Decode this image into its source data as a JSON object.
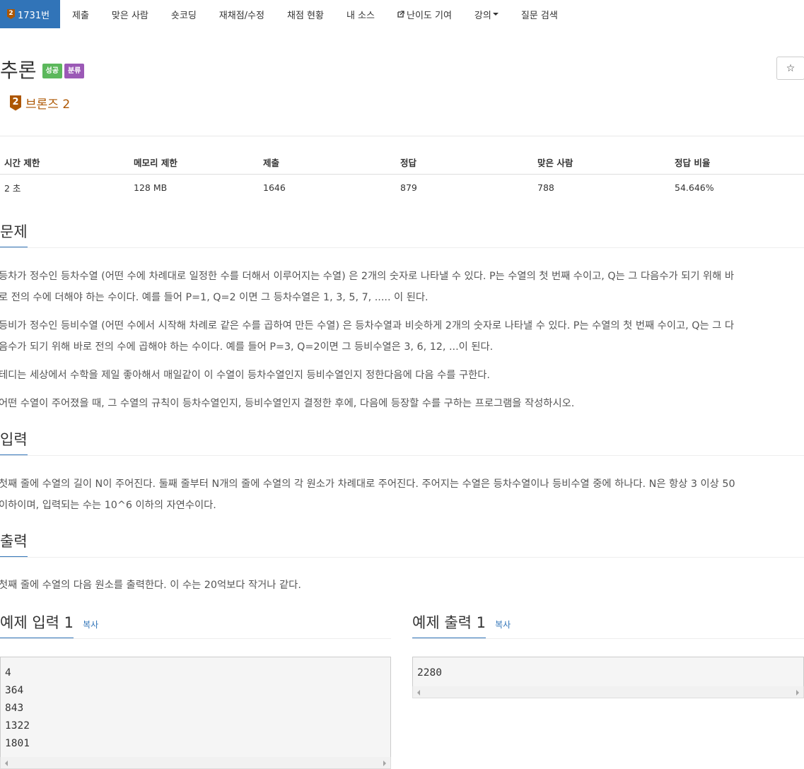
{
  "nav": {
    "problem_tab": {
      "tier_badge": "2",
      "label": "1731번"
    },
    "items": [
      "제출",
      "맞은 사람",
      "숏코딩",
      "재채점/수정",
      "채점 현황",
      "내 소스",
      "난이도 기여",
      "강의",
      "질문 검색"
    ]
  },
  "problem": {
    "title": "추론",
    "labels": [
      "성공",
      "분류"
    ],
    "star": "☆",
    "tier": {
      "number": "2",
      "name": "브론즈 2"
    }
  },
  "info": {
    "headers": [
      "시간 제한",
      "메모리 제한",
      "제출",
      "정답",
      "맞은 사람",
      "정답 비율"
    ],
    "values": [
      "2 초",
      "128 MB",
      "1646",
      "879",
      "788",
      "54.646%"
    ]
  },
  "sections": {
    "problem": {
      "heading": "문제",
      "lines": [
        "등차가 정수인 등차수열 (어떤 수에 차례대로 일정한 수를 더해서 이루어지는 수열) 은 2개의 숫자로 나타낼 수 있다. P는 수열의 첫 번째 수이고, Q는 그 다음수가 되기 위해 바",
        "로 전의 수에 더해야 하는 수이다. 예를 들어 P=1, Q=2 이면 그 등차수열은 1, 3, 5, 7, ..... 이 된다.",
        "등비가 정수인 등비수열 (어떤 수에서 시작해 차례로 같은 수를 곱하여 만든 수열) 은 등차수열과 비슷하게 2개의 숫자로 나타낼 수 있다. P는 수열의 첫 번째 수이고, Q는 그 다",
        "음수가 되기 위해 바로 전의 수에 곱해야 하는 수이다. 예를 들어 P=3, Q=2이면 그 등비수열은 3, 6, 12, ...이 된다.",
        "테디는 세상에서 수학을 제일 좋아해서 매일같이 이 수열이 등차수열인지 등비수열인지 정한다음에 다음 수를 구한다.",
        "어떤 수열이 주어졌을 때, 그 수열의 규칙이 등차수열인지, 등비수열인지 결정한 후에, 다음에 등장할 수를 구하는 프로그램을 작성하시오."
      ]
    },
    "input": {
      "heading": "입력",
      "lines": [
        "첫째 줄에 수열의 길이 N이 주어진다. 둘째 줄부터 N개의 줄에 수열의 각 원소가 차례대로 주어진다. 주어지는 수열은 등차수열이나 등비수열 중에 하나다. N은 항상 3 이상 50",
        "이하이며, 입력되는 수는 10^6 이하의 자연수이다."
      ]
    },
    "output": {
      "heading": "출력",
      "lines": [
        "첫째 줄에 수열의 다음 원소를 출력한다. 이 수는 20억보다 작거나 같다."
      ]
    }
  },
  "samples": {
    "input": {
      "heading": "예제 입력 1",
      "copy": "복사",
      "content": "4\n364\n843\n1322\n1801"
    },
    "output": {
      "heading": "예제 출력 1",
      "copy": "복사",
      "content": "2280"
    }
  }
}
